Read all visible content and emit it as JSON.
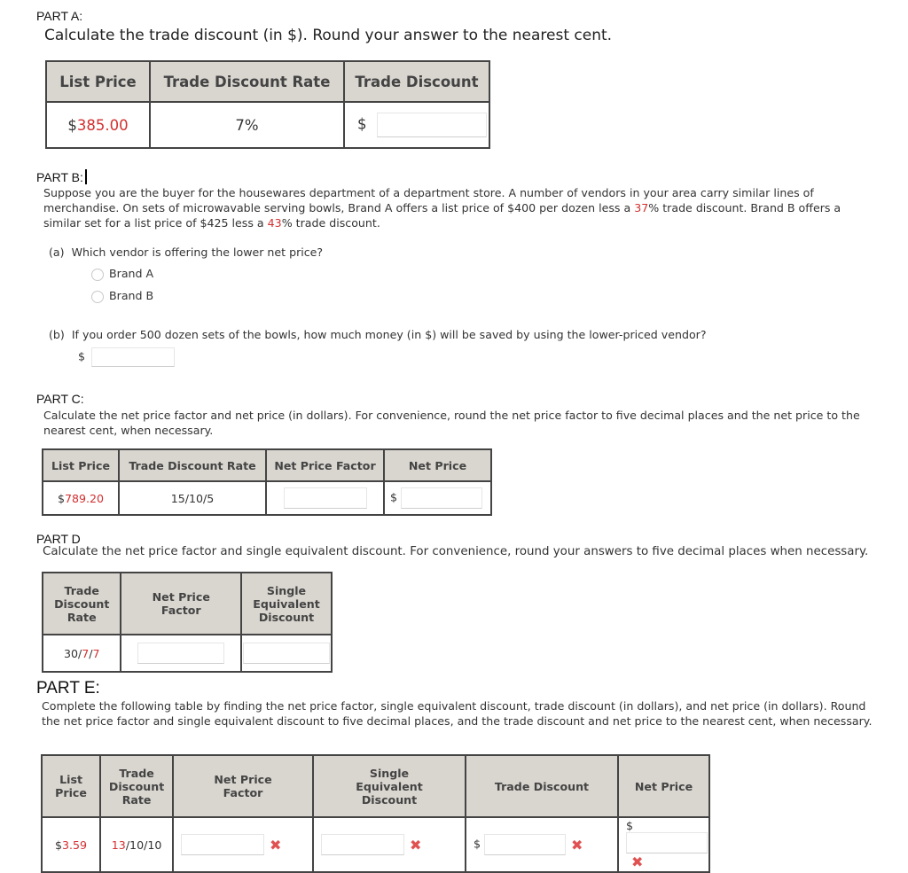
{
  "partA": {
    "label": "PART A:",
    "instruction": "Calculate the trade discount (in $). Round your answer to the nearest cent.",
    "headers": [
      "List Price",
      "Trade Discount Rate",
      "Trade Discount"
    ],
    "list_price_prefix": "$",
    "list_price_value": "385.00",
    "rate": "7%",
    "currency": "$",
    "answer_value": ""
  },
  "partB": {
    "label": "PART B:",
    "paragraph_1": "Suppose you are the buyer for the housewares department of a department store. A number of vendors in your area carry similar lines of merchandise. On sets of microwavable serving bowls, Brand A offers a list price of $400 per dozen less a ",
    "rate_a": "37",
    "paragraph_2": "% trade discount. Brand B offers a similar set for a list price of $425 less a ",
    "rate_b": "43",
    "paragraph_3": "% trade discount.",
    "qa": {
      "marker": "(a)",
      "question": "Which vendor is offering the lower net price?",
      "options": [
        "Brand A",
        "Brand B"
      ]
    },
    "qb": {
      "marker": "(b)",
      "question": "If you order 500 dozen sets of the bowls, how much money (in $) will be saved by using the lower-priced vendor?",
      "currency": "$",
      "answer_value": ""
    }
  },
  "partC": {
    "label": "PART C:",
    "instruction": "Calculate the net price factor and net price (in dollars). For convenience, round the net price factor to five decimal places and the net price to the nearest cent, when necessary.",
    "headers": [
      "List Price",
      "Trade Discount Rate",
      "Net Price Factor",
      "Net Price"
    ],
    "list_price_prefix": "$",
    "list_price_value": "789.20",
    "rate": "15/10/5",
    "currency": "$",
    "npf_value": "",
    "net_price_value": ""
  },
  "partD": {
    "label": "PART D",
    "instruction": "Calculate the net price factor and single equivalent discount. For convenience, round your answers to five decimal places when necessary.",
    "headers": [
      "Trade Discount Rate",
      "Net Price Factor",
      "Single Equivalent Discount"
    ],
    "rate_plain": "30/",
    "rate_red_1": "7",
    "rate_sep": "/",
    "rate_red_2": "7",
    "npf_value": "",
    "sed_value": ""
  },
  "partE": {
    "label": "PART E:",
    "instruction": "Complete the following table by finding the net price factor, single equivalent discount, trade discount (in dollars), and net price (in dollars). Round the net price factor and single equivalent discount to five decimal places, and the trade discount and net price to the nearest cent, when necessary.",
    "headers": [
      "List Price",
      "Trade Discount Rate",
      "Net Price Factor",
      "Single Equivalent Discount",
      "Trade Discount",
      "Net Price"
    ],
    "list_price_prefix": "$",
    "list_price_value": "3.59",
    "rate_red": "13",
    "rate_rest": "/10/10",
    "currency": "$",
    "incorrect_icon": "✖"
  }
}
